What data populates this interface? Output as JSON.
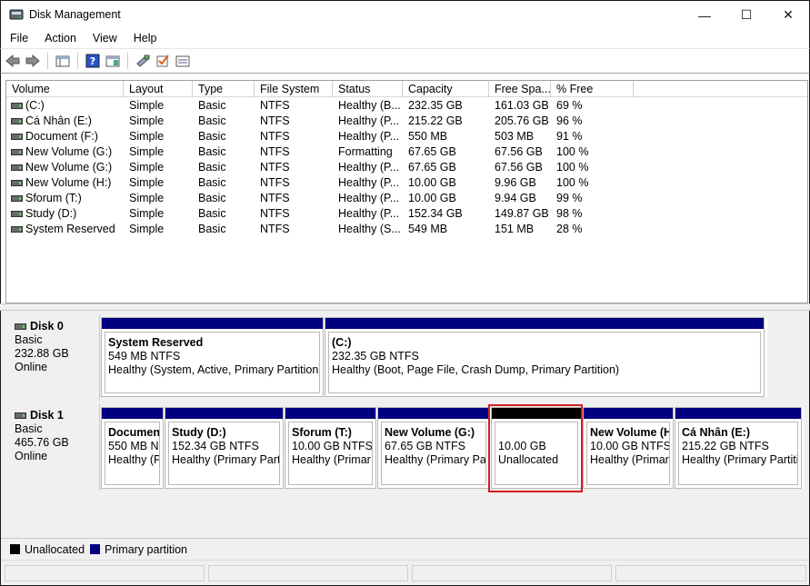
{
  "window": {
    "title": "Disk Management",
    "minimize": "—",
    "maximize": "☐",
    "close": "✕"
  },
  "menu": [
    "File",
    "Action",
    "View",
    "Help"
  ],
  "volumes": {
    "columns": [
      "Volume",
      "Layout",
      "Type",
      "File System",
      "Status",
      "Capacity",
      "Free Spa...",
      "% Free"
    ],
    "rows": [
      [
        "(C:)",
        "Simple",
        "Basic",
        "NTFS",
        "Healthy (B...",
        "232.35 GB",
        "161.03 GB",
        "69 %"
      ],
      [
        "Cá Nhân (E:)",
        "Simple",
        "Basic",
        "NTFS",
        "Healthy (P...",
        "215.22 GB",
        "205.76 GB",
        "96 %"
      ],
      [
        "Document (F:)",
        "Simple",
        "Basic",
        "NTFS",
        "Healthy (P...",
        "550 MB",
        "503 MB",
        "91 %"
      ],
      [
        "New Volume (G:)",
        "Simple",
        "Basic",
        "NTFS",
        "Formatting",
        "67.65 GB",
        "67.56 GB",
        "100 %"
      ],
      [
        "New Volume (G:)",
        "Simple",
        "Basic",
        "NTFS",
        "Healthy (P...",
        "67.65 GB",
        "67.56 GB",
        "100 %"
      ],
      [
        "New Volume (H:)",
        "Simple",
        "Basic",
        "NTFS",
        "Healthy (P...",
        "10.00 GB",
        "9.96 GB",
        "100 %"
      ],
      [
        "Sforum (T:)",
        "Simple",
        "Basic",
        "NTFS",
        "Healthy (P...",
        "10.00 GB",
        "9.94 GB",
        "99 %"
      ],
      [
        "Study (D:)",
        "Simple",
        "Basic",
        "NTFS",
        "Healthy (P...",
        "152.34 GB",
        "149.87 GB",
        "98 %"
      ],
      [
        "System Reserved",
        "Simple",
        "Basic",
        "NTFS",
        "Healthy (S...",
        "549 MB",
        "151 MB",
        "28 %"
      ]
    ]
  },
  "disks": [
    {
      "name": "Disk 0",
      "type": "Basic",
      "size": "232.88 GB",
      "status": "Online",
      "partitions": [
        {
          "name": "System Reserved",
          "size": "549 MB NTFS",
          "status": "Healthy (System, Active, Primary Partition)",
          "kind": "primary"
        },
        {
          "name": "(C:)",
          "size": "232.35 GB NTFS",
          "status": "Healthy (Boot, Page File, Crash Dump, Primary Partition)",
          "kind": "primary"
        }
      ]
    },
    {
      "name": "Disk 1",
      "type": "Basic",
      "size": "465.76 GB",
      "status": "Online",
      "partitions": [
        {
          "name": "Documen",
          "size": "550 MB N",
          "status": "Healthy (P",
          "kind": "primary"
        },
        {
          "name": "Study  (D:)",
          "size": "152.34 GB NTFS",
          "status": "Healthy (Primary Parti",
          "kind": "primary"
        },
        {
          "name": "Sforum  (T:)",
          "size": "10.00 GB NTFS",
          "status": "Healthy (Primar",
          "kind": "primary"
        },
        {
          "name": "New Volume  (G:)",
          "size": "67.65 GB NTFS",
          "status": "Healthy (Primary Pa",
          "kind": "primary"
        },
        {
          "name": "",
          "size": "10.00 GB",
          "status": "Unallocated",
          "kind": "unallocated"
        },
        {
          "name": "New Volume  (H",
          "size": "10.00 GB NTFS",
          "status": "Healthy (Primary",
          "kind": "primary"
        },
        {
          "name": "Cá Nhân  (E:)",
          "size": "215.22 GB NTFS",
          "status": "Healthy (Primary Partiti",
          "kind": "primary"
        }
      ]
    }
  ],
  "legend": [
    {
      "label": "Unallocated",
      "color": "#000000"
    },
    {
      "label": "Primary partition",
      "color": "#000080"
    }
  ],
  "colors": {
    "primary": "#000080",
    "unallocated": "#000000",
    "highlight": "#d32020"
  }
}
